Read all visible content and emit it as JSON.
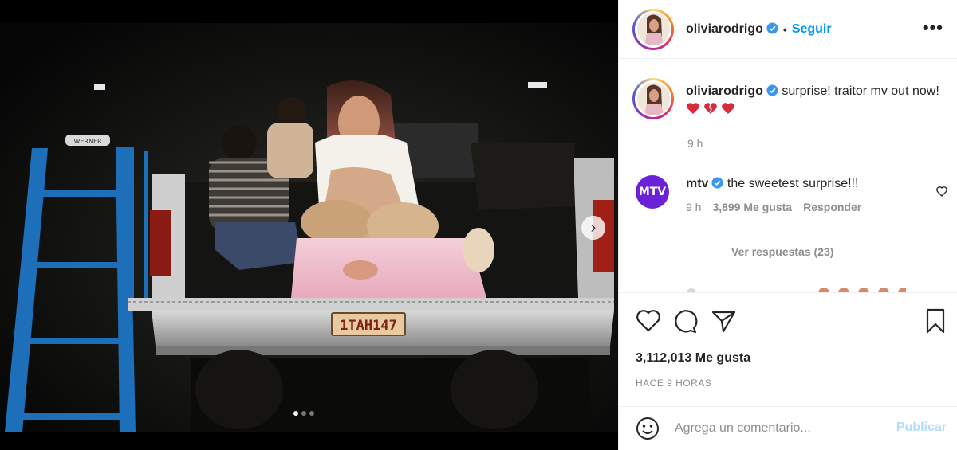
{
  "post": {
    "username": "oliviarodrigo",
    "separator": "•",
    "follow_label": "Seguir",
    "more_label": "•••",
    "carousel": {
      "next_label": "›",
      "slides": 3,
      "active_slide": 0
    },
    "photo": {
      "plate_text": "1TAH147",
      "ladder_label": "WERNER"
    }
  },
  "caption": {
    "username": "oliviarodrigo",
    "text": "surprise! traitor mv out now!",
    "emojis": [
      "heart",
      "broken-heart",
      "heart"
    ],
    "time": "9 h"
  },
  "comments": [
    {
      "username": "mtv",
      "avatar_text": "MTV",
      "text": "the sweetest surprise!!!",
      "time": "9 h",
      "likes": "3,899 Me gusta",
      "reply_label": "Responder"
    }
  ],
  "replies_label": "Ver respuestas (23)",
  "likes_count": "3,112,013 Me gusta",
  "posted_ago": "HACE 9 HORAS",
  "comment_box": {
    "placeholder": "Agrega un comentario...",
    "publish_label": "Publicar"
  },
  "colors": {
    "accent": "#0095f6",
    "verified": "#3897f0",
    "publish_disabled": "#b3dbff",
    "mtv": "#6b21d8"
  }
}
